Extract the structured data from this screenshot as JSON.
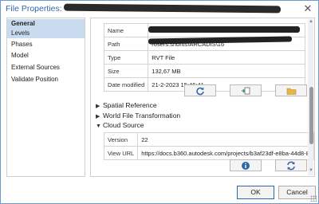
{
  "window": {
    "title": "File Properties:",
    "close_glyph": "✕"
  },
  "sidebar": {
    "items": [
      {
        "label": "General"
      },
      {
        "label": "Levels"
      },
      {
        "label": "Phases"
      },
      {
        "label": "Model"
      },
      {
        "label": "External Sources"
      },
      {
        "label": "Validate Position"
      }
    ]
  },
  "general": {
    "rows": [
      {
        "key": "Name",
        "value": ""
      },
      {
        "key": "Path",
        "value": "rosers.shortis\\ARCADIS\\16"
      },
      {
        "key": "Type",
        "value": "RVT File"
      },
      {
        "key": "Size",
        "value": "132,67 MB"
      },
      {
        "key": "Date modified",
        "value": "21-2-2023 15:46:41"
      }
    ]
  },
  "sections": {
    "spatial_reference": "Spatial Reference",
    "world_file": "World File Transformation",
    "cloud_source": "Cloud Source"
  },
  "cloud": {
    "rows": [
      {
        "key": "Version",
        "value": "22"
      },
      {
        "key": "View URL",
        "value": "https://docs.b360.autodesk.com/projects/b3af23df-e8ba-44d8-8"
      }
    ]
  },
  "footer": {
    "ok_label": "OK",
    "cancel_label": "Cancel"
  },
  "icons": {
    "refresh_color": "#2f68a8",
    "folder_color": "#e8b546",
    "info_color": "#2f68a8"
  }
}
